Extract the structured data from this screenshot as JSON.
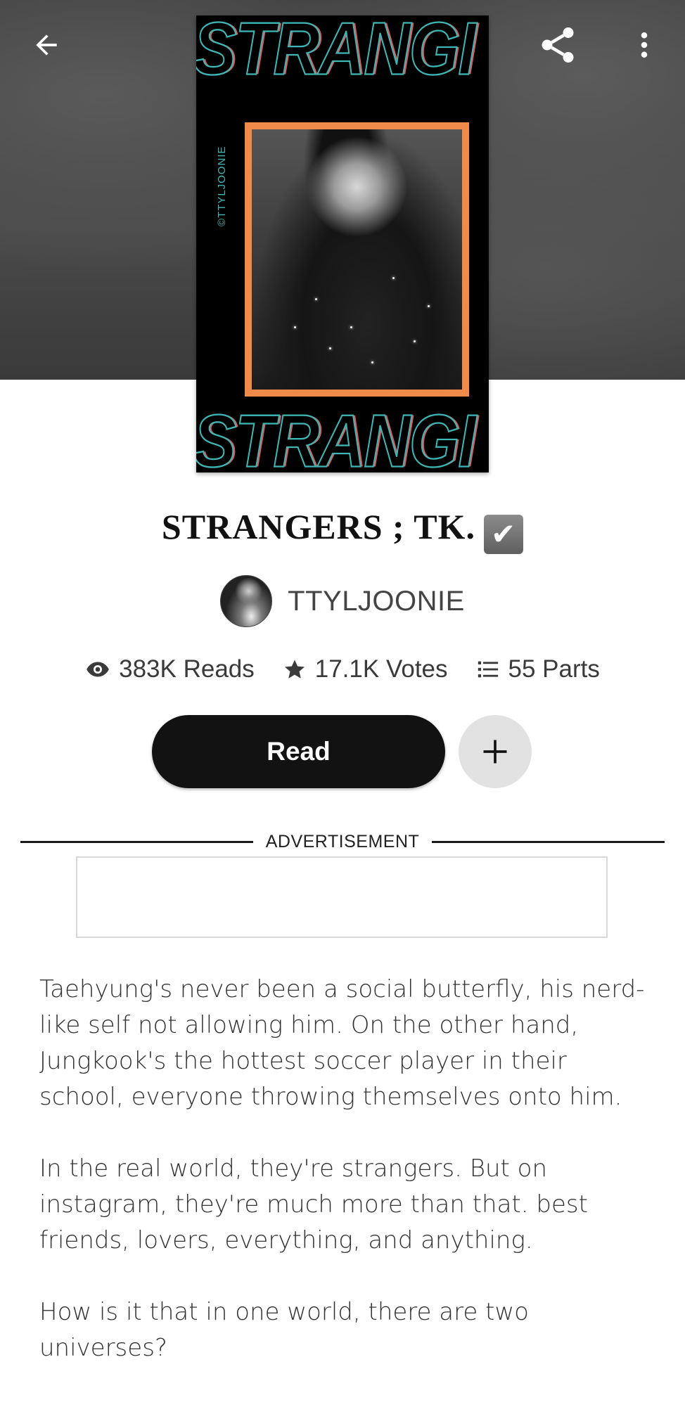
{
  "header": {
    "back_icon": "arrow-left-icon",
    "share_icon": "share-icon",
    "more_icon": "more-vertical-icon"
  },
  "cover": {
    "title_text": "STRANGI",
    "credit_text": "©TTYLJOONIE",
    "frame_color": "#f08a4b",
    "outline_color": "#3fb6b6"
  },
  "story": {
    "title": "STRANGERS ; TK.",
    "title_emoji": "✔",
    "author": "TTYLJOONIE"
  },
  "stats": {
    "reads": "383K Reads",
    "votes": "17.1K Votes",
    "parts": "55 Parts"
  },
  "actions": {
    "read_label": "Read",
    "add_icon": "plus-icon"
  },
  "ad": {
    "label": "ADVERTISEMENT"
  },
  "description": {
    "paragraphs": [
      "Taehyung's never been a social butterfly, his nerd-like self not allowing him. On the other hand, Jungkook's the hottest soccer player in their school, everyone throwing themselves onto him.",
      "In the real world, they're strangers. But on instagram, they're much more than that. best friends, lovers, everything, and anything.",
      "How is it that in one world, there are two universes?"
    ]
  }
}
